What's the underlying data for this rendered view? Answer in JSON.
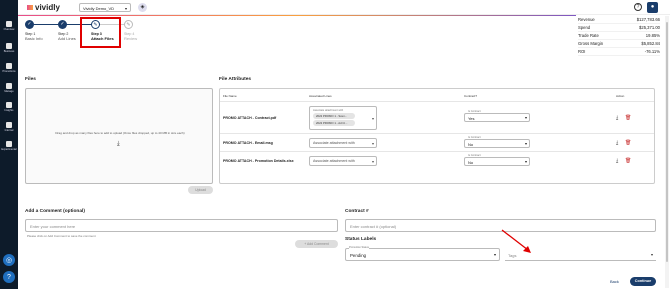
{
  "sidebar": {
    "items": [
      {
        "label": "Overview",
        "icon": "overview-icon"
      },
      {
        "label": "Business",
        "icon": "business-icon"
      },
      {
        "label": "Promotions",
        "icon": "promotions-icon"
      },
      {
        "label": "Manage",
        "icon": "manage-icon"
      },
      {
        "label": "Insights",
        "icon": "insights-icon"
      },
      {
        "label": "Internal",
        "icon": "internal-icon"
      },
      {
        "label": "Experimental",
        "icon": "experimental-icon"
      }
    ]
  },
  "header": {
    "logo": "vividly",
    "tenant": "Vividly Demo_VD",
    "help": "?",
    "user_icon": "user-icon"
  },
  "stepper": {
    "steps": [
      {
        "num": "✓",
        "title": "Step 1",
        "label": "Basic Info",
        "state": "done"
      },
      {
        "num": "✓",
        "title": "Step 2",
        "label": "Add Lines",
        "state": "done"
      },
      {
        "num": "3",
        "title": "Step 3",
        "label": "Attach Files",
        "state": "active"
      },
      {
        "num": "4",
        "title": "Step 4",
        "label": "Review",
        "state": "todo"
      }
    ]
  },
  "summary": [
    {
      "label": "Revenue",
      "value": "$127,783.66"
    },
    {
      "label": "Spend",
      "value": "$25,371.00"
    },
    {
      "label": "Trade Rate",
      "value": "19.85%"
    },
    {
      "label": "Gross Margin",
      "value": "$5,852.84"
    },
    {
      "label": "ROI",
      "value": "-76.11%"
    }
  ],
  "files": {
    "title": "Files",
    "drop_text": "Drag and drop as many files here to add to upload (Once files dropped, up to 40 MB in size each)",
    "upload_label": "Upload"
  },
  "attributes": {
    "title": "File Attributes",
    "headers": {
      "file": "File Name",
      "assoc": "Associated Lines",
      "contract": "Contract?",
      "action": "Action"
    },
    "rows": [
      {
        "name": "PROMO ATTACH - Contract.pdf",
        "assoc_label": "Associate attachment with",
        "chips": [
          "2022 PROMO 1 - Scen...",
          "2022 PROMO 1 - Ad Ci..."
        ],
        "contract_label": "Is Contract",
        "contract": "Yes"
      },
      {
        "name": "PROMO ATTACH - Email.msg",
        "assoc_placeholder": "Associate attachment with",
        "contract_label": "Is Contract",
        "contract": "No"
      },
      {
        "name": "PROMO ATTACH - Promotion Details.xlsx",
        "assoc_placeholder": "Associate attachment with",
        "contract_label": "Is Contract",
        "contract": "No"
      }
    ]
  },
  "comment": {
    "title": "Add a Comment (optional)",
    "placeholder": "Enter your comment here",
    "hint": "Please click on Add Comment to save the comment",
    "button": "+ Add Comment"
  },
  "contract": {
    "title": "Contract #",
    "placeholder": "Enter contract # (optional)"
  },
  "status": {
    "title": "Status Labels",
    "promo_label": "Promotion Status",
    "promo_value": "Pending",
    "tags_placeholder": "Tags"
  },
  "footer": {
    "back": "Back",
    "continue": "Continue"
  }
}
